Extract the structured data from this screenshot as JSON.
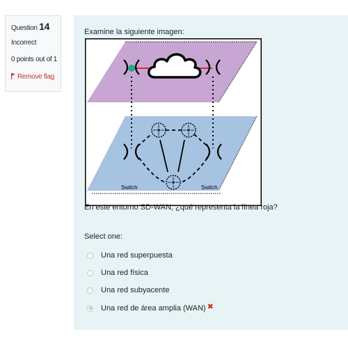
{
  "info": {
    "question_label": "Question",
    "question_number": "14",
    "state": "Incorrect",
    "grade": "0 points out of 1",
    "flag_label": "Remove flag"
  },
  "question": {
    "prompt": "Examine la siguiente imagen:",
    "figure": {
      "switch_left": "Switch",
      "switch_right": "Switch"
    },
    "text": "En este entorno SD-WAN, ¿qué representa la línea roja?",
    "select_label": "Select one:",
    "options": [
      {
        "label": "Una red superpuesta",
        "selected": false
      },
      {
        "label": "Una red física",
        "selected": false
      },
      {
        "label": "Una red subyacente",
        "selected": false
      },
      {
        "label": "Una red de área amplia (WAN)",
        "selected": true,
        "feedback": "incorrect"
      }
    ]
  },
  "colors": {
    "overlay_plane": "#c7a6d3",
    "underlay_plane": "#a7c3e2",
    "red_line": "#e0262a",
    "flag": "#c0392b",
    "wrong": "#ca3120",
    "content_bg": "#e7f3f5"
  }
}
